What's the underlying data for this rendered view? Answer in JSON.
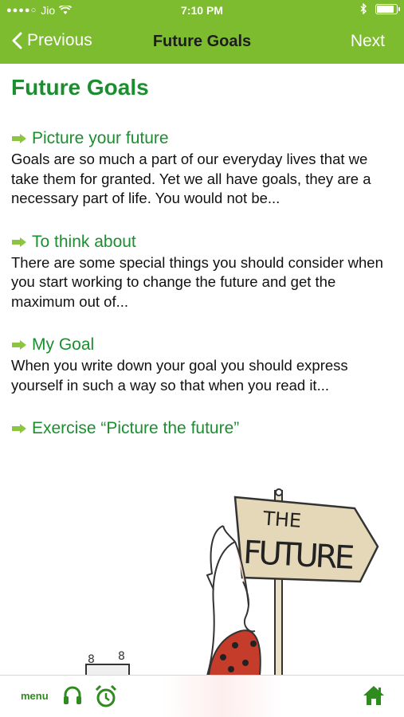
{
  "status_bar": {
    "carrier": "Jio",
    "time": "7:10 PM"
  },
  "nav": {
    "previous_label": "Previous",
    "title": "Future Goals",
    "next_label": "Next"
  },
  "page": {
    "title": "Future Goals",
    "sections": [
      {
        "heading": "Picture your future",
        "body": "Goals are so much a part of our everyday lives that we take them for granted. Yet we all have goals, they are a necessary part of life. You would not be..."
      },
      {
        "heading": "To think about",
        "body": "There are some special things you should consider when you start working to change the future and get the maximum out of..."
      },
      {
        "heading": "My Goal",
        "body": "When you write down your goal you should express yourself in such a way so that when you read it..."
      },
      {
        "heading": "Exercise “Picture the future”",
        "body": ""
      }
    ]
  },
  "illustration": {
    "sign_text_1": "THE",
    "sign_text_2": "FUTURE"
  },
  "tab_bar": {
    "menu_label": "menu"
  },
  "colors": {
    "header_green": "#7dbb2f",
    "heading_green": "#1b8f2f"
  }
}
